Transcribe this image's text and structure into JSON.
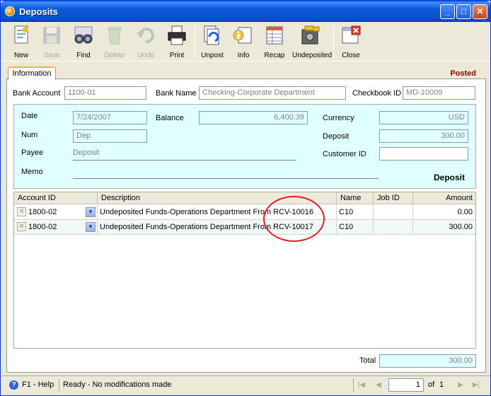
{
  "window": {
    "title": "Deposits"
  },
  "toolbar": {
    "items": [
      {
        "label": "New",
        "icon": "new-document-icon"
      },
      {
        "label": "Save",
        "icon": "save-disk-icon"
      },
      {
        "label": "Find",
        "icon": "binoculars-icon"
      },
      {
        "label": "Delete",
        "icon": "recycle-bin-icon"
      },
      {
        "label": "Undo",
        "icon": "undo-arrow-icon"
      },
      {
        "label": "Print",
        "icon": "printer-icon"
      },
      {
        "label": "Unpost",
        "icon": "unpost-icon"
      },
      {
        "label": "Info",
        "icon": "info-icon"
      },
      {
        "label": "Recap",
        "icon": "recap-grid-icon"
      },
      {
        "label": "Undeposited",
        "icon": "safe-icon"
      },
      {
        "label": "Close",
        "icon": "close-window-icon"
      }
    ]
  },
  "tab": {
    "label": "Information"
  },
  "status_label": "Posted",
  "header": {
    "bank_account_label": "Bank Account",
    "bank_account": "1100-01",
    "bank_name_label": "Bank Name",
    "bank_name": "Checking-Corporate Department",
    "checkbook_id_label": "Checkbook ID",
    "checkbook_id": "MD-10009"
  },
  "info": {
    "date_label": "Date",
    "date": "7/24/2007",
    "balance_label": "Balance",
    "balance": "6,400.39",
    "currency_label": "Currency",
    "currency": "USD",
    "num_label": "Num",
    "num": "Dep",
    "deposit_label": "Deposit",
    "deposit": "300.00",
    "payee_label": "Payee",
    "payee": "Deposit",
    "customer_id_label": "Customer ID",
    "customer_id": "",
    "memo_label": "Memo",
    "memo": "",
    "type_label": "Deposit"
  },
  "grid": {
    "columns": [
      "Account ID",
      "Description",
      "Name",
      "Job ID",
      "Amount"
    ],
    "rows": [
      {
        "account_id": "1800-02",
        "description": "Undeposited Funds-Operations Department From RCV-10016",
        "name": "C10",
        "job_id": "",
        "amount": "0.00"
      },
      {
        "account_id": "1800-02",
        "description": "Undeposited Funds-Operations Department From RCV-10017",
        "name": "C10",
        "job_id": "",
        "amount": "300.00"
      }
    ]
  },
  "total": {
    "label": "Total",
    "value": "300.00"
  },
  "statusbar": {
    "help": "F1 - Help",
    "message": "Ready - No modifications made",
    "page": "1",
    "of_label": "of",
    "page_count": "1"
  }
}
